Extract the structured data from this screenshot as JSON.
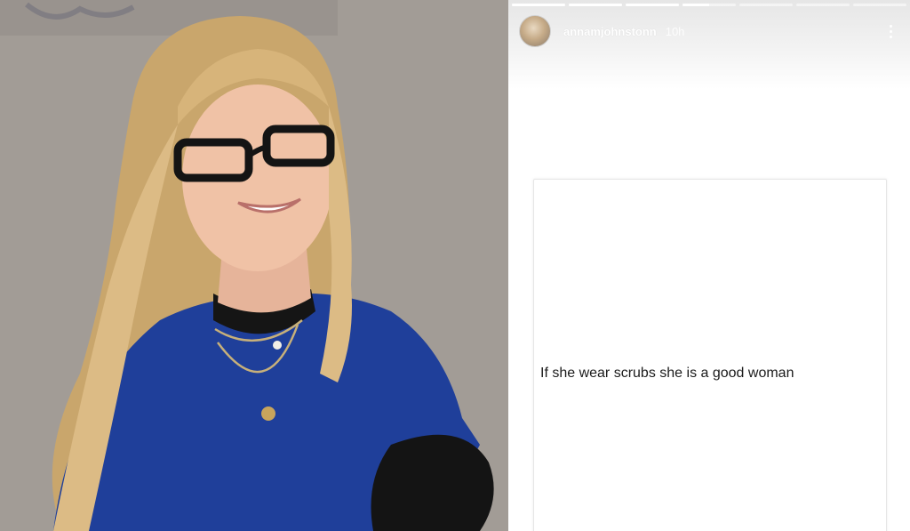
{
  "story": {
    "username": "annamjohnstonn",
    "timestamp": "10h",
    "progress": [
      1,
      1,
      1,
      0.5,
      0,
      0,
      0
    ],
    "post_text": "If she wear scrubs she is a good woman"
  },
  "icons": {
    "more": "more-vertical-icon"
  },
  "colors": {
    "scrubs": "#1f3f9a",
    "hair": "#d7b47a",
    "background_wall": "#a39e98"
  }
}
